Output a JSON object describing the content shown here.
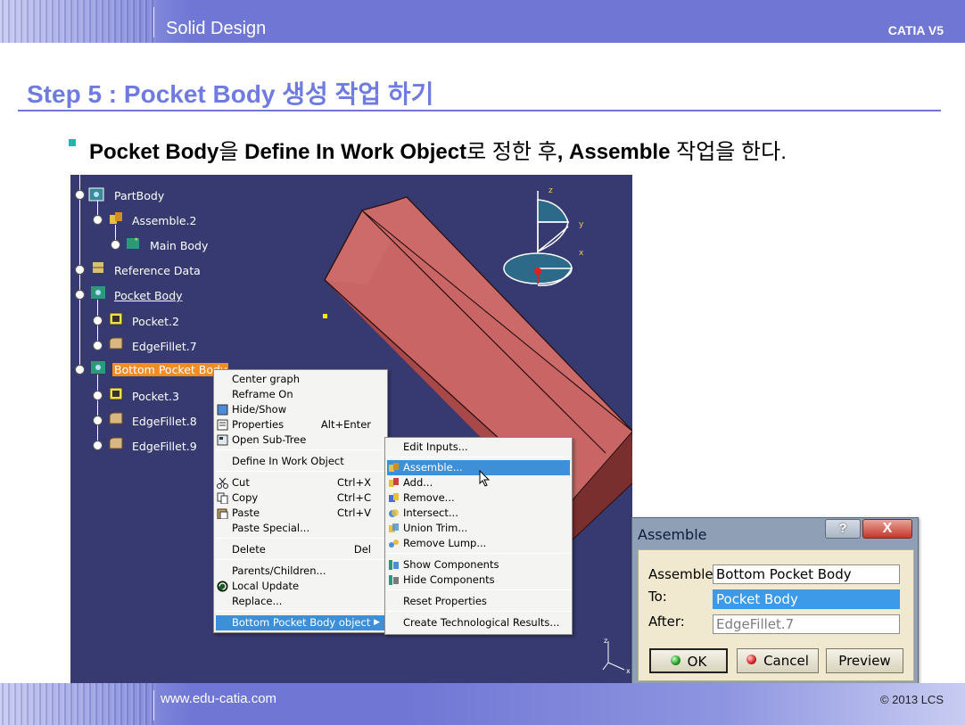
{
  "header": {
    "title": "Solid Design",
    "product": "CATIA V5"
  },
  "slide": {
    "title": "Step 5 : Pocket Body 생성 작업 하기",
    "bullet": {
      "part1": "Pocket Body",
      "part2": "을 ",
      "part3": "Define In Work Object",
      "part4": "로 정한 후",
      "part5": ", Assemble",
      "part6": " 작업을 한다."
    }
  },
  "tree": {
    "items": [
      {
        "label": "PartBody",
        "icon": "body-icon"
      },
      {
        "label": "Assemble.2",
        "icon": "assemble-icon"
      },
      {
        "label": "Main Body",
        "icon": "body-star-icon"
      },
      {
        "label": "Reference Data",
        "icon": "reference-icon"
      },
      {
        "label": "Pocket Body",
        "icon": "body-icon"
      },
      {
        "label": "Pocket.2",
        "icon": "pocket-icon"
      },
      {
        "label": "EdgeFillet.7",
        "icon": "fillet-icon"
      },
      {
        "label": "Bottom Pocket Body",
        "icon": "body-icon"
      },
      {
        "label": "Pocket.3",
        "icon": "pocket-icon"
      },
      {
        "label": "EdgeFillet.8",
        "icon": "fillet-icon"
      },
      {
        "label": "EdgeFillet.9",
        "icon": "fillet-icon"
      }
    ]
  },
  "compass": {
    "z": "z",
    "y": "y",
    "x": "x"
  },
  "axis_small": {
    "z": "z",
    "x": "x"
  },
  "context_menu": {
    "items": [
      {
        "label": "Center graph",
        "shortcut": ""
      },
      {
        "label": "Reframe On",
        "shortcut": ""
      },
      {
        "label": "Hide/Show",
        "shortcut": "",
        "icon": "hide-show-icon"
      },
      {
        "label": "Properties",
        "shortcut": "Alt+Enter",
        "icon": "properties-icon"
      },
      {
        "label": "Open Sub-Tree",
        "shortcut": "",
        "icon": "subtree-icon"
      },
      {
        "label": "Define In Work Object",
        "shortcut": ""
      },
      {
        "label": "Cut",
        "shortcut": "Ctrl+X",
        "icon": "scissors-icon"
      },
      {
        "label": "Copy",
        "shortcut": "Ctrl+C",
        "icon": "copy-icon"
      },
      {
        "label": "Paste",
        "shortcut": "Ctrl+V",
        "icon": "paste-icon"
      },
      {
        "label": "Paste Special...",
        "shortcut": ""
      },
      {
        "label": "Delete",
        "shortcut": "Del"
      },
      {
        "label": "Parents/Children...",
        "shortcut": ""
      },
      {
        "label": "Local Update",
        "shortcut": "",
        "icon": "update-icon"
      },
      {
        "label": "Replace...",
        "shortcut": ""
      },
      {
        "label": "Bottom Pocket Body object",
        "shortcut": ""
      }
    ]
  },
  "submenu": {
    "items": [
      {
        "label": "Edit Inputs..."
      },
      {
        "label": "Assemble...",
        "icon": "assemble-icon"
      },
      {
        "label": "Add...",
        "icon": "add-icon"
      },
      {
        "label": "Remove...",
        "icon": "remove-icon"
      },
      {
        "label": "Intersect...",
        "icon": "intersect-icon"
      },
      {
        "label": "Union Trim...",
        "icon": "union-trim-icon"
      },
      {
        "label": "Remove Lump...",
        "icon": "remove-lump-icon"
      },
      {
        "label": "Show Components",
        "icon": "show-components-icon"
      },
      {
        "label": "Hide Components",
        "icon": "hide-components-icon"
      },
      {
        "label": "Reset Properties"
      },
      {
        "label": "Create Technological Results..."
      }
    ]
  },
  "dialog": {
    "title": "Assemble",
    "help": "?",
    "close": "X",
    "assemble_label": "Assemble",
    "assemble_value": "Bottom Pocket Body",
    "to_label": "To:",
    "to_value": "Pocket Body",
    "after_label": "After:",
    "after_value": "EdgeFillet.7",
    "ok": "OK",
    "cancel": "Cancel",
    "preview": "Preview"
  },
  "footer": {
    "url": "www.edu-catia.com",
    "copyright": "© 2013 LCS"
  },
  "colors": {
    "accent": "#6f76d4",
    "title": "#6f7be0",
    "viewport": "#363a70",
    "part": "#c45f5f",
    "highlight": "#f28d24",
    "menu_selected": "#3d8fd8"
  }
}
